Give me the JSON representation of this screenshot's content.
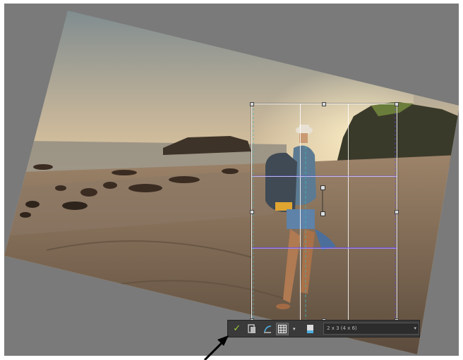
{
  "toolbar": {
    "apply_label": "✓",
    "preset_value": "2 x 3 (4 x 6)",
    "accent_color": "#9bd13a"
  },
  "colors": {
    "workspace": "#7a7a7a",
    "toolbar_bg": "#3a3a3a",
    "overlay_guides": "#6a4cff"
  },
  "icons": [
    "check-icon",
    "crop-size-icon",
    "rotate-icon",
    "grid-icon",
    "grid-dropdown-icon",
    "aspect-ratio-icon",
    "chevron-down-icon",
    "arrow-annotation"
  ]
}
